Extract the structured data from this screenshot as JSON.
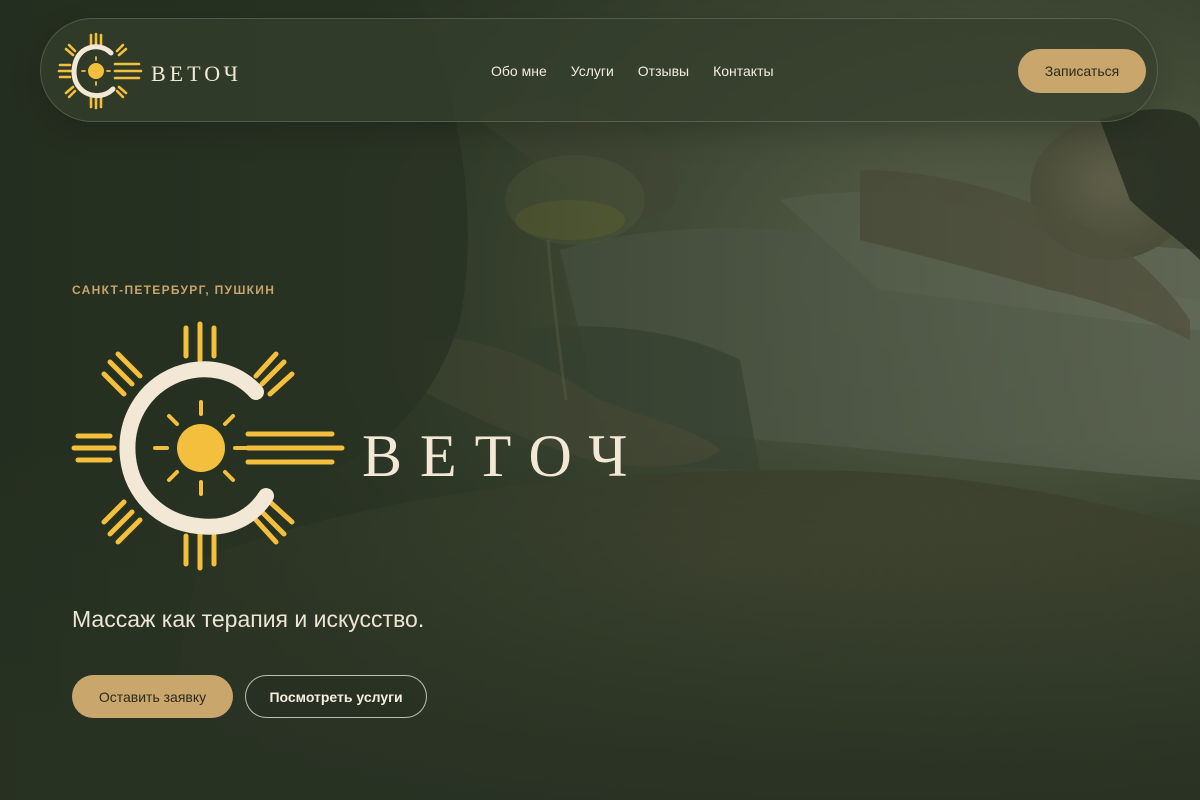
{
  "brand": {
    "name": "ВЕТОЧ",
    "initial": "С"
  },
  "nav": {
    "links": [
      "Обо мне",
      "Услуги",
      "Отзывы",
      "Контакты"
    ],
    "cta_label": "Записаться"
  },
  "hero": {
    "kicker": "САНКТ-ПЕТЕРБУРГ, ПУШКИН",
    "brand_name": "ВЕТОЧ",
    "tagline": "Массаж как терапия и искусство.",
    "primary_button": "Оставить заявку",
    "secondary_button": "Посмотреть услуги",
    "background_image": "massage-oil-photo"
  },
  "colors": {
    "accent_gold": "#c9a66b",
    "sun_yellow": "#f4bf3c",
    "cream": "#f2e8d5",
    "overlay_green": "#2a3324"
  },
  "icons": {
    "logo_mark": "sun-c-icon"
  }
}
